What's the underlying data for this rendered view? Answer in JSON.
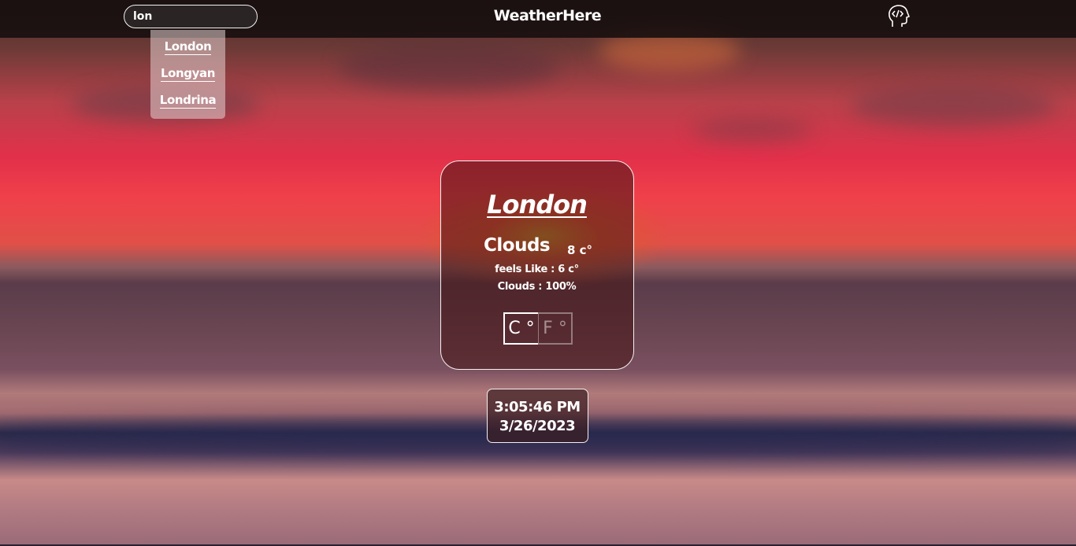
{
  "header": {
    "search_value": "lon",
    "brand_title": "WeatherHere",
    "dev_icon": "developer-head-icon"
  },
  "suggestions": [
    "London",
    "Longyan",
    "Londrina"
  ],
  "weather": {
    "city": "London",
    "condition": "Clouds",
    "temperature": "8 c°",
    "feels_like": "feels Like : 6 c°",
    "clouds": "Clouds : 100%",
    "unit_c": "C °",
    "unit_f": "F °",
    "selected_unit": "C"
  },
  "clock": {
    "time": "3:05:46 PM",
    "date": "3/26/2023"
  },
  "colors": {
    "navbar": "#140e0e",
    "text": "#ffffff",
    "sky_red": "#f0404a"
  }
}
